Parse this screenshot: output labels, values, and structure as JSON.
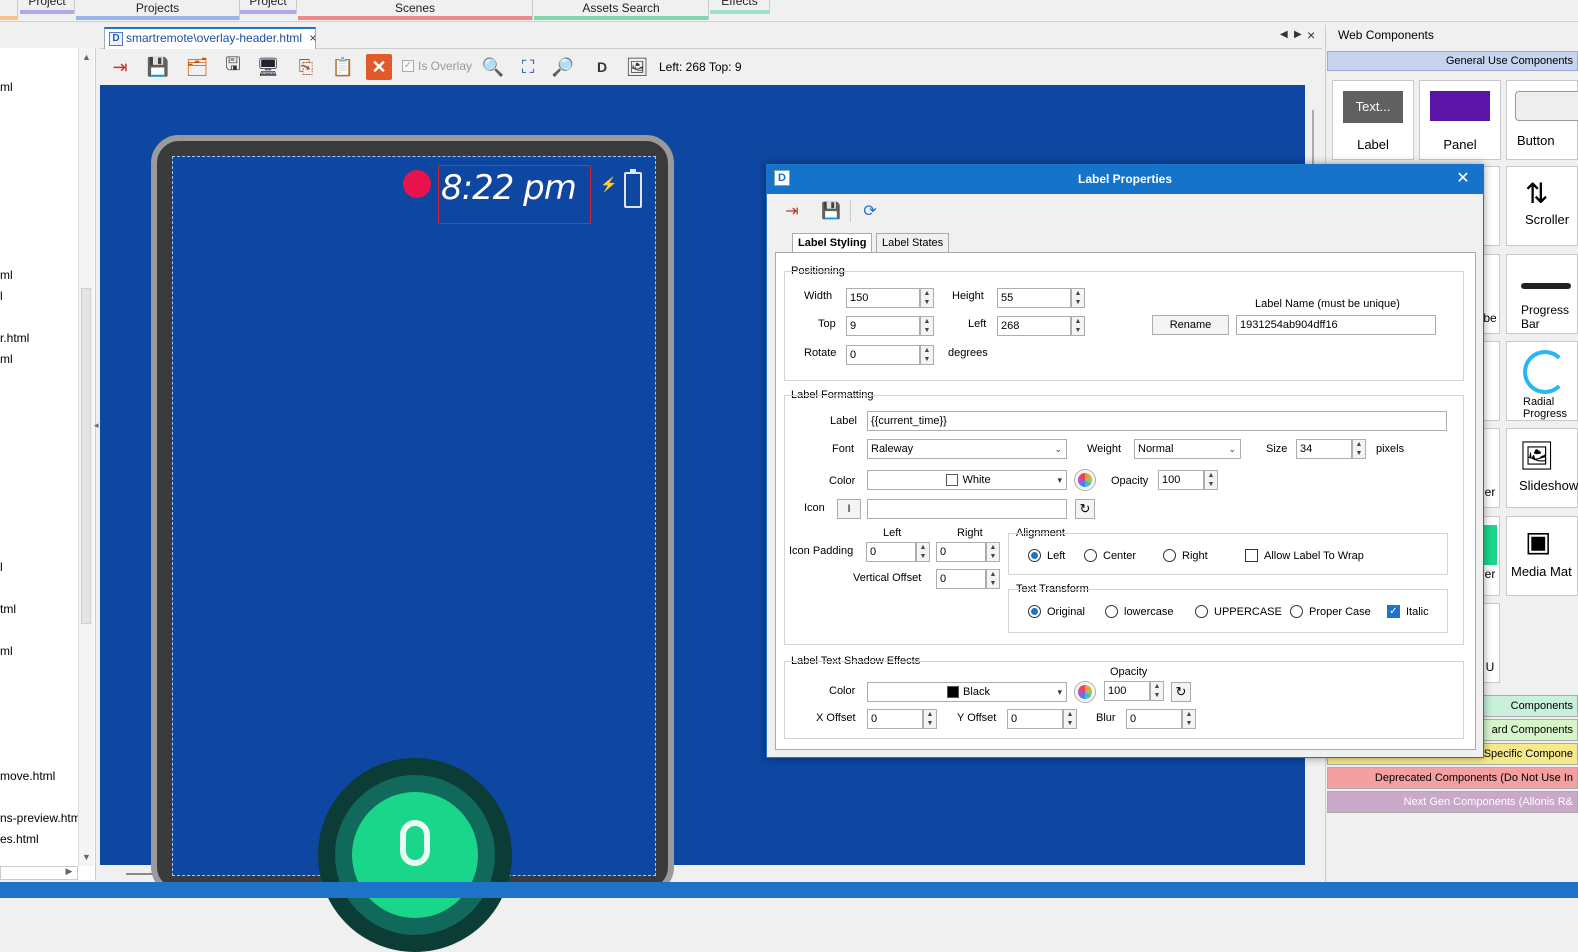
{
  "top_tabs": [
    {
      "label": "Project",
      "color": "#b7a6e8"
    },
    {
      "label": "Projects",
      "color": "#9ab5e8"
    },
    {
      "label": "Project",
      "color": "#b7a6e8"
    },
    {
      "label": "Scenes",
      "color": "#f08a8a"
    },
    {
      "label": "Assets Search",
      "color": "#7fd6b0"
    },
    {
      "label": "Effects",
      "color": "#9ee0d0"
    }
  ],
  "left_files": [
    "ml",
    "ml",
    "l",
    "r.html",
    "ml",
    "l",
    "tml",
    "ml",
    "move.html",
    "ns-preview.htm",
    "es.html"
  ],
  "doc_tab": {
    "label": "smartremote\\overlay-header.html",
    "icon": "D",
    "close": "×"
  },
  "toolbar": {
    "is_overlay_label": "Is Overlay",
    "position_readout": "Left: 268 Top: 9"
  },
  "canvas": {
    "time_text": "8:22 pm",
    "accent_red": "#e8124f",
    "canvas_blue": "#0d47a1"
  },
  "dialog": {
    "title": "Label Properties",
    "icon": "D",
    "close": "✕",
    "tabs": [
      "Label Styling",
      "Label States"
    ],
    "positioning": {
      "group_title": "Positioning",
      "width_label": "Width",
      "width_value": "150",
      "height_label": "Height",
      "height_value": "55",
      "top_label": "Top",
      "top_value": "9",
      "left_label": "Left",
      "left_value": "268",
      "rotate_label": "Rotate",
      "rotate_value": "0",
      "degrees_label": "degrees",
      "rename_button": "Rename",
      "name_label": "Label Name (must be unique)",
      "name_value": "1931254ab904dff16"
    },
    "formatting": {
      "group_title": "Label Formatting",
      "label_label": "Label",
      "label_value": "{{current_time}}",
      "font_label": "Font",
      "font_value": "Raleway",
      "weight_label": "Weight",
      "weight_value": "Normal",
      "size_label": "Size",
      "size_value": "34",
      "pixels_label": "pixels",
      "color_label": "Color",
      "color_value": "White",
      "color_hex": "#ffffff",
      "opacity_label": "Opacity",
      "opacity_value": "100",
      "icon_label": "Icon",
      "icon_button": "I",
      "icon_padding_label": "Icon Padding",
      "pad_left_label": "Left",
      "pad_left_value": "0",
      "pad_right_label": "Right",
      "pad_right_value": "0",
      "vertical_offset_label": "Vertical Offset",
      "vertical_offset_value": "0",
      "alignment_title": "Alignment",
      "align_left": "Left",
      "align_center": "Center",
      "align_right": "Right",
      "wrap_label": "Allow Label To Wrap",
      "transform_title": "Text Transform",
      "t_original": "Original",
      "t_lower": "lowercase",
      "t_upper": "UPPERCASE",
      "t_proper": "Proper Case",
      "t_italic": "Italic"
    },
    "shadow": {
      "group_title": "Label Text Shadow Effects",
      "color_label": "Color",
      "color_value": "Black",
      "color_hex": "#000000",
      "opacity_label": "Opacity",
      "opacity_value": "100",
      "x_label": "X Offset",
      "x_value": "0",
      "y_label": "Y Offset",
      "y_value": "0",
      "blur_label": "Blur",
      "blur_value": "0"
    }
  },
  "components": {
    "panel_title": "Web Components",
    "general_section": "General Use Components",
    "tiles": [
      {
        "label": "Label",
        "preview": "Text..."
      },
      {
        "label": "Panel"
      },
      {
        "label": "Button"
      },
      {
        "label": "Scroller"
      },
      {
        "label": "Progress Bar"
      },
      {
        "label": "Radial Progress"
      },
      {
        "label": "Slideshow"
      },
      {
        "label": "Media Mat"
      }
    ],
    "partial_labels": [
      "be",
      "er",
      "er",
      "U"
    ],
    "sections": [
      {
        "label": "Components",
        "color": "#c9f0da"
      },
      {
        "label": "ard Components",
        "color": "#d6f5c8"
      },
      {
        "label": "Specific Compone",
        "color": "#f5e98a"
      },
      {
        "label": "Deprecated Components (Do Not Use In",
        "color": "#f4a0a0"
      },
      {
        "label": "Next Gen Components (Allonis R&",
        "color": "#c9a8c9"
      }
    ]
  }
}
